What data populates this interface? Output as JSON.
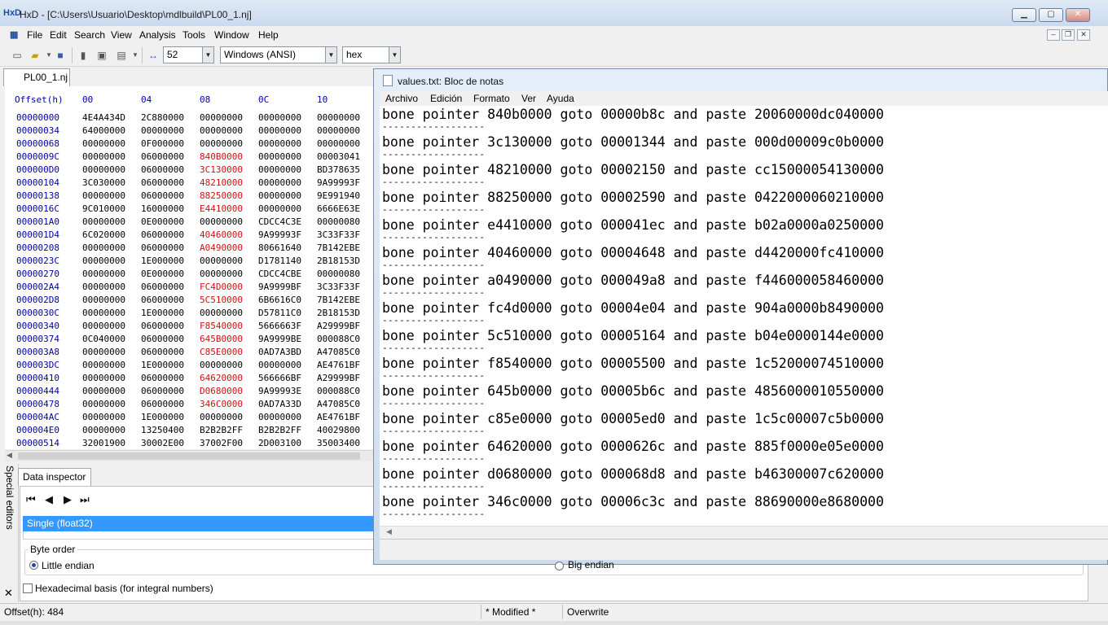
{
  "hxd": {
    "title": "HxD - [C:\\Users\\Usuario\\Desktop\\mdlbuild\\PL00_1.nj]",
    "app_icon": "HxD",
    "menu": [
      "File",
      "Edit",
      "Search",
      "View",
      "Analysis",
      "Tools",
      "Window",
      "Help"
    ],
    "toolbar": {
      "bytes_per_row": "52",
      "charset": "Windows (ANSI)",
      "offset_base": "hex"
    },
    "tab_label": "PL00_1.nj",
    "hex_header": {
      "offset": "Offset(h)",
      "columns": [
        "00",
        "04",
        "08",
        "0C",
        "10"
      ]
    },
    "rows": [
      {
        "offset": "00000000",
        "cells": [
          "4E4A434D",
          "2C880000",
          "00000000",
          "00000000",
          "00000000"
        ],
        "hl": -1
      },
      {
        "offset": "00000034",
        "cells": [
          "64000000",
          "00000000",
          "00000000",
          "00000000",
          "00000000"
        ],
        "hl": -1
      },
      {
        "offset": "00000068",
        "cells": [
          "00000000",
          "0F000000",
          "00000000",
          "00000000",
          "00000000"
        ],
        "hl": -1
      },
      {
        "offset": "0000009C",
        "cells": [
          "00000000",
          "06000000",
          "840B0000",
          "00000000",
          "00003041"
        ],
        "hl": 2
      },
      {
        "offset": "000000D0",
        "cells": [
          "00000000",
          "06000000",
          "3C130000",
          "00000000",
          "BD378635"
        ],
        "hl": 2
      },
      {
        "offset": "00000104",
        "cells": [
          "3C030000",
          "06000000",
          "48210000",
          "00000000",
          "9A99993F"
        ],
        "hl": 2
      },
      {
        "offset": "00000138",
        "cells": [
          "00000000",
          "06000000",
          "88250000",
          "00000000",
          "9E991940"
        ],
        "hl": 2
      },
      {
        "offset": "0000016C",
        "cells": [
          "9C010000",
          "16000000",
          "E4410000",
          "00000000",
          "6666E63E"
        ],
        "hl": 2
      },
      {
        "offset": "000001A0",
        "cells": [
          "00000000",
          "0E000000",
          "00000000",
          "CDCC4C3E",
          "00000080"
        ],
        "hl": -1
      },
      {
        "offset": "000001D4",
        "cells": [
          "6C020000",
          "06000000",
          "40460000",
          "9A99993F",
          "3C33F33F"
        ],
        "hl": 2
      },
      {
        "offset": "00000208",
        "cells": [
          "00000000",
          "06000000",
          "A0490000",
          "80661640",
          "7B142EBE"
        ],
        "hl": 2
      },
      {
        "offset": "0000023C",
        "cells": [
          "00000000",
          "1E000000",
          "00000000",
          "D1781140",
          "2B18153D"
        ],
        "hl": -1
      },
      {
        "offset": "00000270",
        "cells": [
          "00000000",
          "0E000000",
          "00000000",
          "CDCC4CBE",
          "00000080"
        ],
        "hl": -1
      },
      {
        "offset": "000002A4",
        "cells": [
          "00000000",
          "06000000",
          "FC4D0000",
          "9A9999BF",
          "3C33F33F"
        ],
        "hl": 2
      },
      {
        "offset": "000002D8",
        "cells": [
          "00000000",
          "06000000",
          "5C510000",
          "6B6616C0",
          "7B142EBE"
        ],
        "hl": 2
      },
      {
        "offset": "0000030C",
        "cells": [
          "00000000",
          "1E000000",
          "00000000",
          "D57811C0",
          "2B18153D"
        ],
        "hl": -1
      },
      {
        "offset": "00000340",
        "cells": [
          "00000000",
          "06000000",
          "F8540000",
          "5666663F",
          "A29999BF"
        ],
        "hl": 2
      },
      {
        "offset": "00000374",
        "cells": [
          "0C040000",
          "06000000",
          "645B0000",
          "9A9999BE",
          "000088C0"
        ],
        "hl": 2
      },
      {
        "offset": "000003A8",
        "cells": [
          "00000000",
          "06000000",
          "C85E0000",
          "0AD7A3BD",
          "A47085C0"
        ],
        "hl": 2
      },
      {
        "offset": "000003DC",
        "cells": [
          "00000000",
          "1E000000",
          "00000000",
          "00000000",
          "AE4761BF"
        ],
        "hl": -1
      },
      {
        "offset": "00000410",
        "cells": [
          "00000000",
          "06000000",
          "64620000",
          "566666BF",
          "A29999BF"
        ],
        "hl": 2
      },
      {
        "offset": "00000444",
        "cells": [
          "00000000",
          "06000000",
          "D0680000",
          "9A99993E",
          "000088C0"
        ],
        "hl": 2
      },
      {
        "offset": "00000478",
        "cells": [
          "00000000",
          "06000000",
          "346C0000",
          "0AD7A33D",
          "A47085C0"
        ],
        "hl": 2
      },
      {
        "offset": "000004AC",
        "cells": [
          "00000000",
          "1E000000",
          "00000000",
          "00000000",
          "AE4761BF"
        ],
        "hl": -1
      },
      {
        "offset": "000004E0",
        "cells": [
          "00000000",
          "13250400",
          "B2B2B2FF",
          "B2B2B2FF",
          "40029800"
        ],
        "hl": -1
      },
      {
        "offset": "00000514",
        "cells": [
          "32001900",
          "30002E00",
          "37002F00",
          "2D003100",
          "35003400"
        ],
        "hl": -1
      }
    ],
    "data_inspector": {
      "tab_label": "Data inspector",
      "selected_type": "Single (float32)",
      "byte_order_label": "Byte order",
      "little_endian": "Little endian",
      "big_endian": "Big endian",
      "hex_basis": "Hexadecimal basis (for integral numbers)"
    },
    "special_editors_label": "Special editors",
    "status": {
      "offset": "Offset(h): 484",
      "modified": "* Modified *",
      "mode": "Overwrite"
    },
    "colors": {
      "offset_blue": "#0000a8",
      "highlight_red": "#d01010",
      "selection_blue": "#3399ff"
    },
    "icons": [
      "new-file-icon",
      "open-file-icon",
      "save-icon",
      "delete-icon",
      "print-icon",
      "properties-icon",
      "bytes-per-row-icon",
      "first-icon",
      "prev-icon",
      "next-icon",
      "last-icon"
    ]
  },
  "notepad": {
    "title": "values.txt: Bloc de notas",
    "menu": [
      "Archivo",
      "Edición",
      "Formato",
      "Ver",
      "Ayuda"
    ],
    "separator": "------------------",
    "lines": [
      "bone pointer 840b0000 goto 00000b8c and paste 20060000dc040000",
      "bone pointer 3c130000 goto 00001344 and paste 000d00009c0b0000",
      "bone pointer 48210000 goto 00002150 and paste cc15000054130000",
      "bone pointer 88250000 goto 00002590 and paste 0422000060210000",
      "bone pointer e4410000 goto 000041ec and paste b02a0000a0250000",
      "bone pointer 40460000 goto 00004648 and paste d4420000fc410000",
      "bone pointer a0490000 goto 000049a8 and paste f446000058460000",
      "bone pointer fc4d0000 goto 00004e04 and paste 904a0000b8490000",
      "bone pointer 5c510000 goto 00005164 and paste b04e0000144e0000",
      "bone pointer f8540000 goto 00005500 and paste 1c52000074510000",
      "bone pointer 645b0000 goto 00005b6c and paste 4856000010550000",
      "bone pointer c85e0000 goto 00005ed0 and paste 1c5c00007c5b0000",
      "bone pointer 64620000 goto 0000626c and paste 885f0000e05e0000",
      "bone pointer d0680000 goto 000068d8 and paste b46300007c620000",
      "bone pointer 346c0000 goto 00006c3c and paste 88690000e8680000"
    ]
  }
}
